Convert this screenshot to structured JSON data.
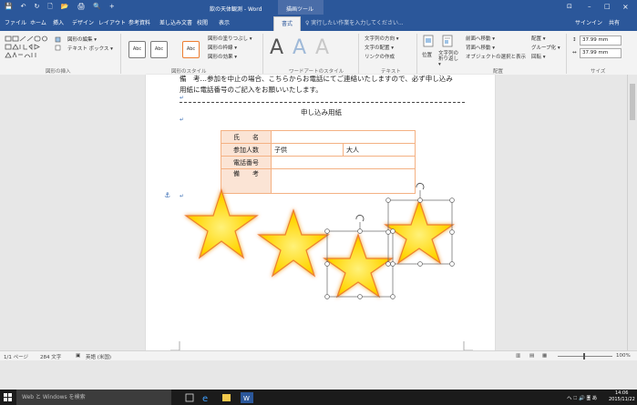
{
  "titlebar": {
    "doc_title": "飲の天体観測 - Word",
    "context_tab_group": "描画ツール",
    "quick_access": [
      "💾",
      "↶",
      "↻",
      "🗋",
      "📂",
      "🖨",
      "🔍",
      "+"
    ],
    "window_controls": [
      "⊡",
      "–",
      "□",
      "×"
    ]
  },
  "tabs": {
    "items": [
      "ファイル",
      "ホーム",
      "挿入",
      "デザイン",
      "レイアウト",
      "参考資料",
      "差し込み文書",
      "校閲",
      "表示",
      "書式"
    ],
    "tell_me": "♀ 実行したい作業を入力してください...",
    "signin": "サインイン",
    "share": "共有"
  },
  "ribbon": {
    "g1": {
      "edit_shape": "図形の編集 ▾",
      "textbox": "テキスト ボックス ▾",
      "label": "図形の挿入"
    },
    "g2": {
      "styles": [
        "Abc",
        "Abc",
        "Abc"
      ],
      "fill": "図形の塗りつぶし ▾",
      "outline": "図形の枠線 ▾",
      "effect": "図形の効果 ▾",
      "label": "図形のスタイル"
    },
    "g3": {
      "letters": [
        "A",
        "A",
        "A"
      ],
      "label": "ワードアートのスタイル"
    },
    "g4": {
      "direction": "文字列の方向 ▾",
      "align": "文字の配置 ▾",
      "link": "リンクの作成",
      "label": "テキスト"
    },
    "g5": {
      "position": "位置",
      "wrap": "文字列の折り返し ▾",
      "forward": "前面へ移動 ▾",
      "backward": "背面へ移動 ▾",
      "selection": "オブジェクトの選択と表示",
      "align": "配置 ▾",
      "group": "グループ化 ▾",
      "rotate": "回転 ▾",
      "label": "配置"
    },
    "g6": {
      "height": "37.99 mm",
      "width": "37.99 mm",
      "label": "サイズ"
    }
  },
  "document": {
    "line1": "備　考…参加を中止の場合、こちらからお電話にてご連絡いたしますので、必ず申し込み",
    "line2": "用紙に電話番号のご記入をお願いいたします。",
    "return_mark": "↵",
    "form_title": "申し込み用紙",
    "anchor": "⚓",
    "table": [
      [
        "氏　　名",
        "",
        "",
        ""
      ],
      [
        "参加人数",
        "子供",
        "大人",
        ""
      ],
      [
        "電話番号",
        "",
        "",
        ""
      ],
      [
        "備　　考",
        "",
        "",
        ""
      ]
    ]
  },
  "status": {
    "page": "1/1 ページ",
    "words": "284 文字",
    "lang": "英語 (米国)",
    "zoom": "100%",
    "view_buttons": [
      "▥",
      "▤",
      "▦"
    ]
  },
  "taskbar": {
    "search": "Web と Windows を検索",
    "time": "14:06",
    "date": "2015/11/22",
    "tray": "ヘ 🗆 🔊 🗏 あ"
  },
  "colors": {
    "brand": "#2b579a",
    "star_fill": "#ffd400",
    "star_stroke": "#ed7d31",
    "table_border": "#ed7d31"
  }
}
